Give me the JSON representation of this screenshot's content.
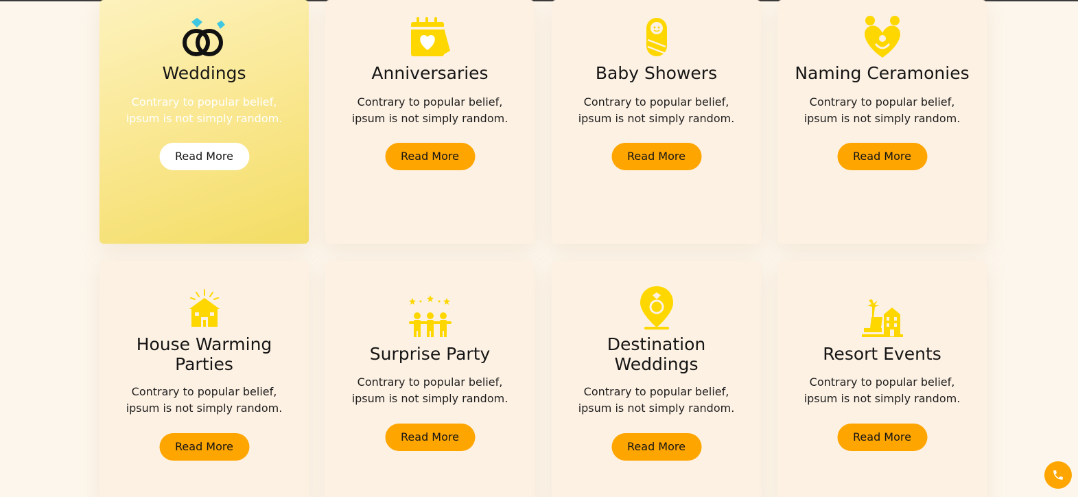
{
  "colors": {
    "accent": "#ffa500",
    "icon_yellow": "#ffd700",
    "card_bg": "#fdf1e3",
    "page_bg": "#fdf6ec"
  },
  "cards": [
    {
      "title": "Weddings",
      "desc_line1": "Contrary to popular belief,",
      "desc_line2": "ipsum is not simply random.",
      "button": "Read More",
      "icon": "wedding-rings-icon",
      "active": true
    },
    {
      "title": "Anniversaries",
      "desc_line1": "Contrary to popular belief,",
      "desc_line2": "ipsum is not simply random.",
      "button": "Read More",
      "icon": "calendar-heart-icon"
    },
    {
      "title": "Baby Showers",
      "desc_line1": "Contrary to popular belief,",
      "desc_line2": "ipsum is not simply random.",
      "button": "Read More",
      "icon": "swaddled-baby-icon"
    },
    {
      "title": "Naming Ceramonies",
      "desc_line1": "Contrary to popular belief,",
      "desc_line2": "ipsum is not simply random.",
      "button": "Read More",
      "icon": "family-heart-icon"
    },
    {
      "title_line1": "House Warming",
      "title_line2": "Parties",
      "desc_line1": "Contrary to popular belief,",
      "desc_line2": "ipsum is not simply random.",
      "button": "Read More",
      "icon": "house-fireworks-icon"
    },
    {
      "title": "Surprise Party",
      "desc_line1": "Contrary to popular belief,",
      "desc_line2": "ipsum is not simply random.",
      "button": "Read More",
      "icon": "party-people-icon"
    },
    {
      "title_line1": "Destination",
      "title_line2": "Weddings",
      "desc_line1": "Contrary to popular belief,",
      "desc_line2": "ipsum is not simply random.",
      "button": "Read More",
      "icon": "ring-location-pin-icon"
    },
    {
      "title": "Resort Events",
      "desc_line1": "Contrary to popular belief,",
      "desc_line2": "ipsum is not simply random.",
      "button": "Read More",
      "icon": "resort-palm-icon"
    }
  ],
  "phone_button": {
    "icon": "phone-icon"
  }
}
